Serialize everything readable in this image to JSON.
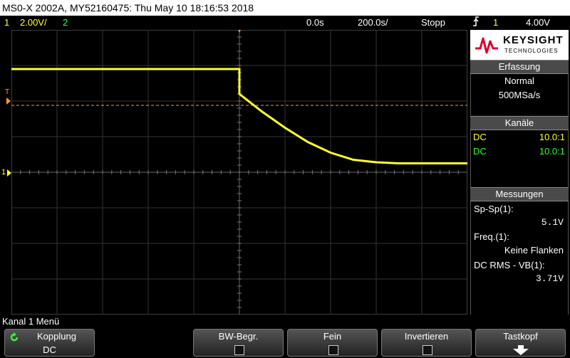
{
  "title_bar": {
    "text": "MS0-X 2002A, MY52160475: Thu May 10 18:16:53 2018"
  },
  "status_bar": {
    "ch1_num": "1",
    "ch1_scale": "2.00V/",
    "ch2_num": "2",
    "time_offset": "0.0s",
    "timebase": "200.0s/",
    "run_state": "Stopp",
    "trigger_icon": "trigger-edge-icon",
    "trigger_source": "1",
    "trigger_level": "4.00V"
  },
  "brand": {
    "name": "KEYSIGHT",
    "sub": "TECHNOLOGIES",
    "logo_color": "#e0002a"
  },
  "acquisition": {
    "header": "Erfassung",
    "mode": "Normal",
    "rate": "500MSa/s"
  },
  "channels": {
    "header": "Kanäle",
    "items": [
      {
        "coupling": "DC",
        "probe": "10.0:1",
        "color": "#ffff33"
      },
      {
        "coupling": "DC",
        "probe": "10.0:1",
        "color": "#33ff33"
      }
    ]
  },
  "measurements": {
    "header": "Messungen",
    "items": [
      {
        "label": "Sp-Sp(1):",
        "value": "5.1V"
      },
      {
        "label": "Freq.(1):",
        "value": "Keine Flanken"
      },
      {
        "label": "DC RMS - VB(1):",
        "value": "3.71V"
      }
    ]
  },
  "screen_markers": {
    "trigger_label": "T",
    "ground_label": "1"
  },
  "waveform": {
    "color": "#ffff33",
    "volts_per_div": 2.0,
    "samples_divs": [
      [
        0,
        1.1
      ],
      [
        5,
        1.1
      ],
      [
        5,
        1.8
      ],
      [
        5.5,
        2.3
      ],
      [
        6,
        2.75
      ],
      [
        6.5,
        3.15
      ],
      [
        7,
        3.45
      ],
      [
        7.5,
        3.65
      ],
      [
        8,
        3.72
      ],
      [
        8.5,
        3.75
      ],
      [
        10,
        3.75
      ]
    ]
  },
  "menu": {
    "title": "Kanal 1 Menü",
    "softkeys": [
      {
        "label": "Kopplung",
        "value": "DC"
      },
      {
        "label": "BW-Begr."
      },
      {
        "label": "Fein"
      },
      {
        "label": "Invertieren"
      },
      {
        "label": "Tastkopf"
      }
    ]
  }
}
